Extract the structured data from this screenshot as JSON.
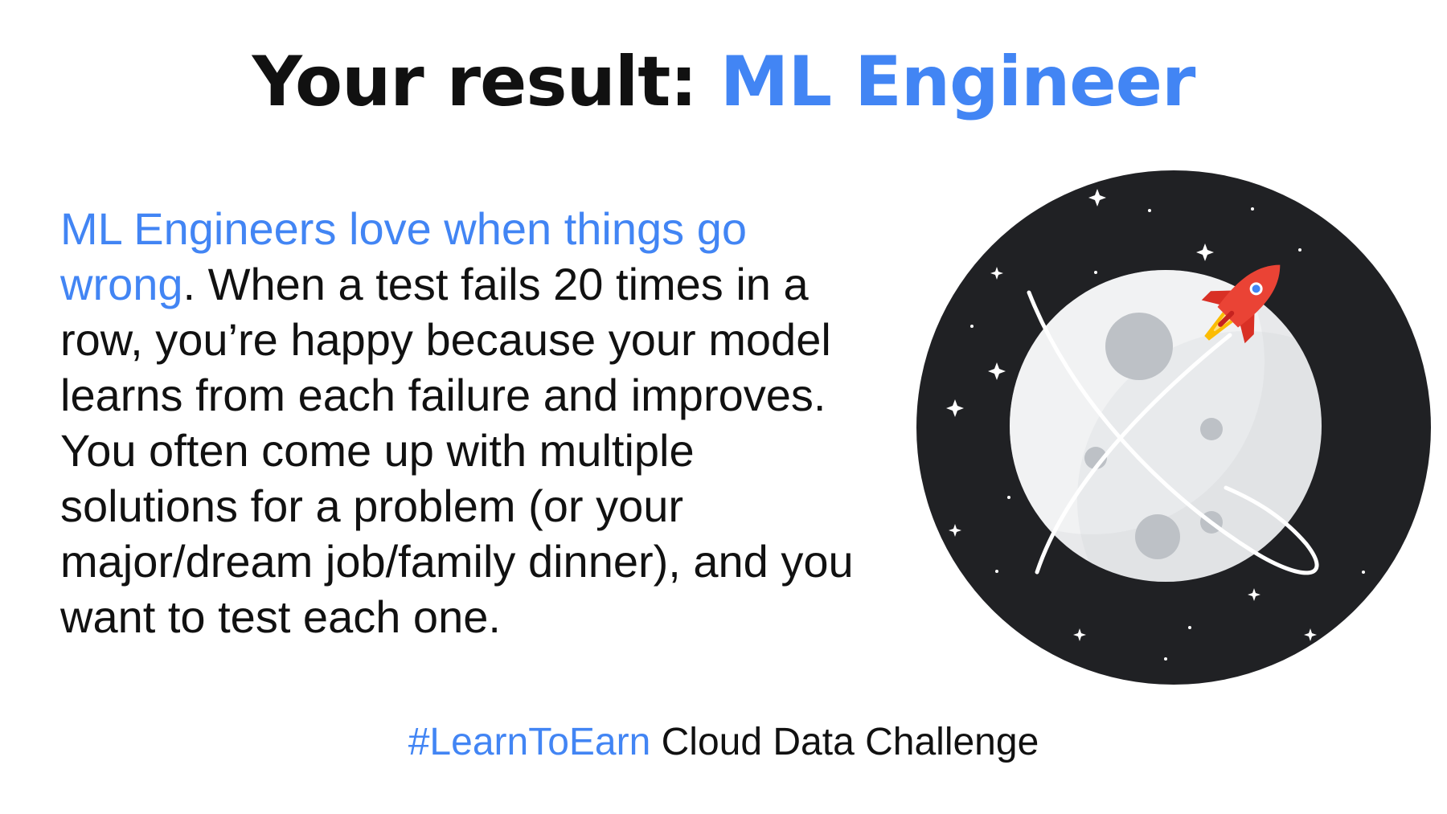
{
  "headline": {
    "prefix": "Your result:",
    "role": "ML Engineer"
  },
  "description": {
    "highlight": "ML Engineers love when things go wrong",
    "text": ". When a test fails 20 times in a row, you’re happy because your model learns from each failure and improves. You often come up with multiple solutions for a problem (or your major/dream job/family dinner), and you want to test each one."
  },
  "illustration": {
    "icon": "moon-rocket-icon",
    "colors": {
      "space": "#202124",
      "moon": "#e8e9eb",
      "crater": "#bdc1c6",
      "rocket": "#ea4335",
      "flame": "#fbbc04"
    }
  },
  "footer": {
    "hashtag": "#LearnToEarn",
    "label": "Cloud Data Challenge"
  },
  "colors": {
    "accent": "#4285f4",
    "text": "#111111",
    "background": "#ffffff"
  }
}
